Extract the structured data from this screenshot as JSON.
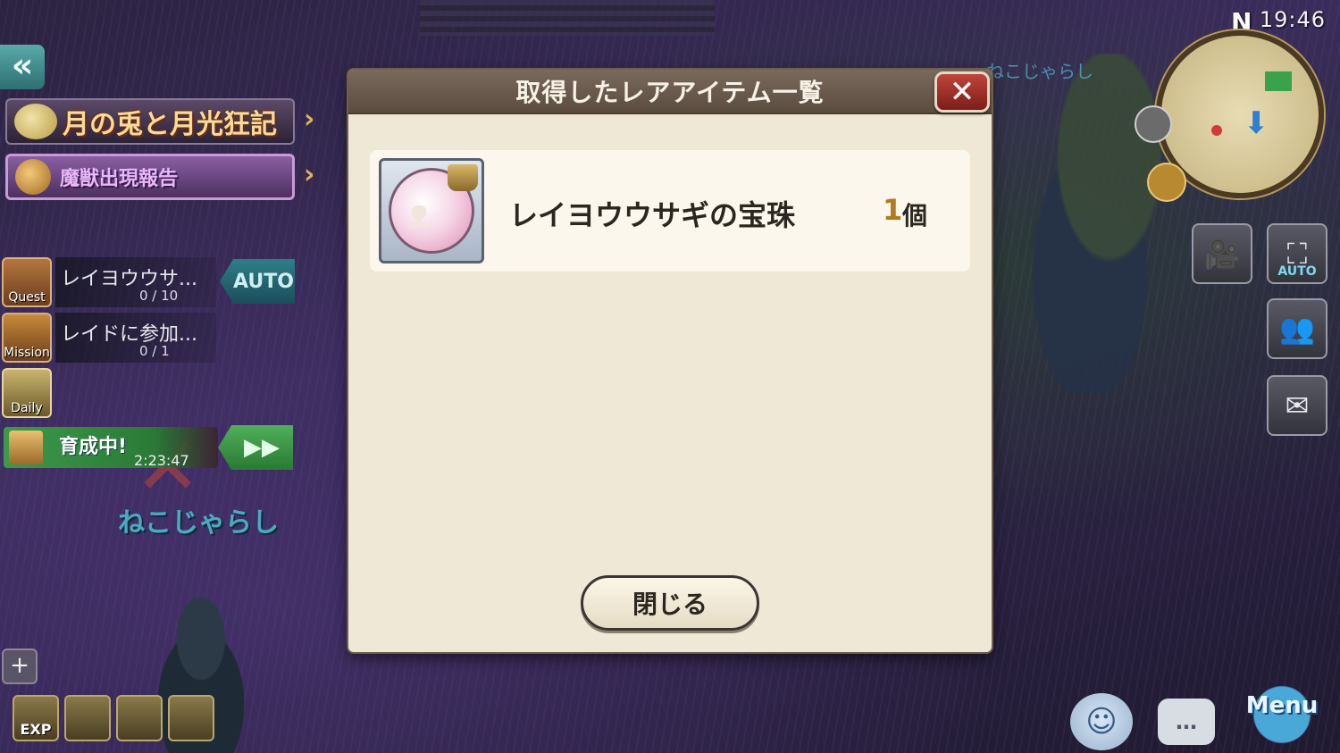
{
  "modal": {
    "title": "取得したレアアイテム一覧",
    "close_x": "✕",
    "items": [
      {
        "name": "レイヨウウサギの宝珠",
        "quantity": "1",
        "unit": "個",
        "icon": "rabbit-orb-icon"
      }
    ],
    "close_button": "閉じる"
  },
  "hud": {
    "clock": "19:46",
    "north": "N",
    "back_icon": "«",
    "event_banner": "月の兎と月光狂記",
    "report_banner": "魔獣出現報告",
    "quests": [
      {
        "icon_label": "Quest",
        "name": "レイヨウウサ...",
        "progress": "0 / 10"
      },
      {
        "icon_label": "Mission",
        "name": "レイドに参加...",
        "progress": "0 / 1"
      }
    ],
    "auto_label": "AUTO",
    "daily_label": "Daily",
    "training": {
      "label": "育成中!",
      "timer": "2:23:47",
      "ff_icon": "▶▶"
    },
    "player_name": "ねこじゃらし",
    "right_name": "ねこじゃらし",
    "plus_icon": "+",
    "bottom_icons": [
      "EXP",
      "",
      "",
      ""
    ],
    "side_buttons": [
      {
        "icon": "camera-icon",
        "glyph": "🎥",
        "label": ""
      },
      {
        "icon": "auto-camera-icon",
        "glyph": "⛶",
        "label": "AUTO"
      },
      {
        "icon": "party-icon",
        "glyph": "👥",
        "label": ""
      },
      {
        "icon": "mail-icon",
        "glyph": "✉",
        "label": ""
      }
    ],
    "menu_label": "Menu",
    "chat_glyph": "…",
    "emote_glyph": "☺"
  }
}
